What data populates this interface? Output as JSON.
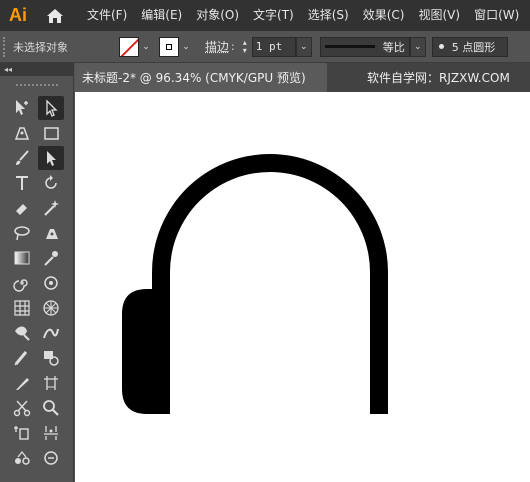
{
  "app": {
    "logo": "Ai"
  },
  "menu": [
    "文件(F)",
    "编辑(E)",
    "对象(O)",
    "文字(T)",
    "选择(S)",
    "效果(C)",
    "视图(V)",
    "窗口(W)"
  ],
  "control": {
    "selection_label": "未选择对象",
    "stroke_label": "描边",
    "colon": ":",
    "stroke_weight": "1 pt",
    "profile_label": "等比",
    "brush_label": "5 点圆形"
  },
  "toolbar": {
    "collapse_label": "◂◂"
  },
  "document": {
    "tab_title": "未标题-2* @ 96.34% (CMYK/GPU 预览)",
    "watermark": "软件自学网：RJZXW.COM"
  },
  "colors": {
    "accent": "#ff9a00",
    "none_stroke": "#e02020",
    "artwork": "#000000",
    "canvas": "#ffffff"
  },
  "icons": [
    "home-icon",
    "stroke-none-swatch",
    "fill-swatch",
    "selection-tool-icon",
    "direct-selection-tool-icon",
    "pen-tool-icon",
    "rectangle-tool-icon",
    "brush-tool-icon",
    "pencil-tool-icon",
    "type-tool-icon",
    "rotate-tool-icon",
    "eraser-tool-icon",
    "magic-wand-icon",
    "lasso-icon",
    "curvature-pen-icon",
    "gradient-tool-icon",
    "eyedropper-icon",
    "spiral-icon",
    "symbol-sprayer-icon",
    "grid-tool-icon",
    "perspective-grid-icon",
    "width-tool-icon",
    "puppet-warp-icon",
    "column-graph-icon",
    "shape-builder-icon",
    "knife-icon",
    "artboard-icon",
    "scissors-icon",
    "zoom-tool-icon",
    "slice-icon",
    "hand-tool-icon"
  ]
}
